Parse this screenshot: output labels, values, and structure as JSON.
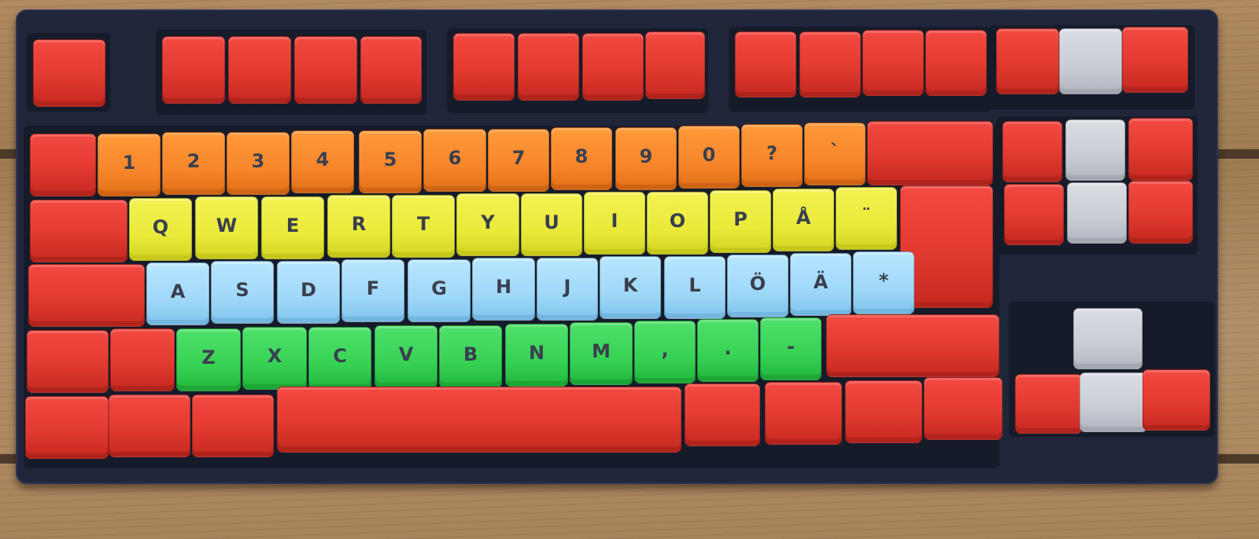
{
  "colors": {
    "red": "#e23a30",
    "orange": "#f7862a",
    "yellow": "#e9ea3a",
    "blue": "#9fd8f8",
    "green": "#36d254",
    "gray": "#c9ccd4",
    "case": "#20263a",
    "table_wood": "#a8845c"
  },
  "keyboard": {
    "layout": "Swedish / Nordic tenkeyless",
    "number_row": [
      "1",
      "2",
      "3",
      "4",
      "5",
      "6",
      "7",
      "8",
      "9",
      "0",
      "?",
      "`"
    ],
    "top_row": [
      "Q",
      "W",
      "E",
      "R",
      "T",
      "Y",
      "U",
      "I",
      "O",
      "P",
      "Å",
      "¨"
    ],
    "home_row": [
      "A",
      "S",
      "D",
      "F",
      "G",
      "H",
      "J",
      "K",
      "L",
      "Ö",
      "Ä",
      "*"
    ],
    "bottom_row": [
      "Z",
      "X",
      "C",
      "V",
      "B",
      "N",
      "M",
      ",",
      ".",
      "-"
    ]
  }
}
